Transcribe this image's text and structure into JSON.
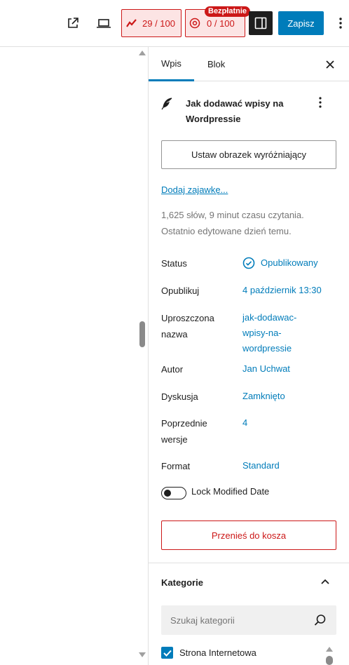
{
  "toolbar": {
    "external_icon": "external-link-icon",
    "preview_icon": "desktop-preview-icon",
    "seo_score": "29 / 100",
    "readability_score": "0 / 100",
    "free_badge": "Bezpłatnie",
    "save_label": "Zapisz",
    "accent": "#007cba",
    "alert": "#cc1818"
  },
  "sidebar": {
    "tabs": [
      {
        "label": "Wpis",
        "active": true
      },
      {
        "label": "Blok",
        "active": false
      }
    ],
    "post_title": "Jak dodawać wpisy na Wordpressie",
    "featured_image_button": "Ustaw obrazek wyróżniający",
    "excerpt_link": "Dodaj zajawkę...",
    "stats": "1,625 słów, 9 minut czasu czytania.",
    "last_edited": "Ostatnio edytowane dzień temu.",
    "rows": [
      {
        "label": "Status",
        "value": "Opublikowany"
      },
      {
        "label": "Opublikuj",
        "value": "4 październik 13:30"
      },
      {
        "label": "Uproszczona nazwa",
        "value": "jak-dodawac-wpisy-na-wordpressie"
      },
      {
        "label": "Autor",
        "value": "Jan Uchwat"
      },
      {
        "label": "Dyskusja",
        "value": "Zamknięto"
      },
      {
        "label": "Poprzednie wersje",
        "value": "4"
      },
      {
        "label": "Format",
        "value": "Standard"
      }
    ],
    "lock_modified_label": "Lock Modified Date",
    "lock_modified_on": false,
    "trash_button": "Przenieś do kosza",
    "categories": {
      "title": "Kategorie",
      "search_placeholder": "Szukaj kategorii",
      "items": [
        {
          "label": "Strona Internetowa",
          "checked": true
        }
      ]
    }
  }
}
